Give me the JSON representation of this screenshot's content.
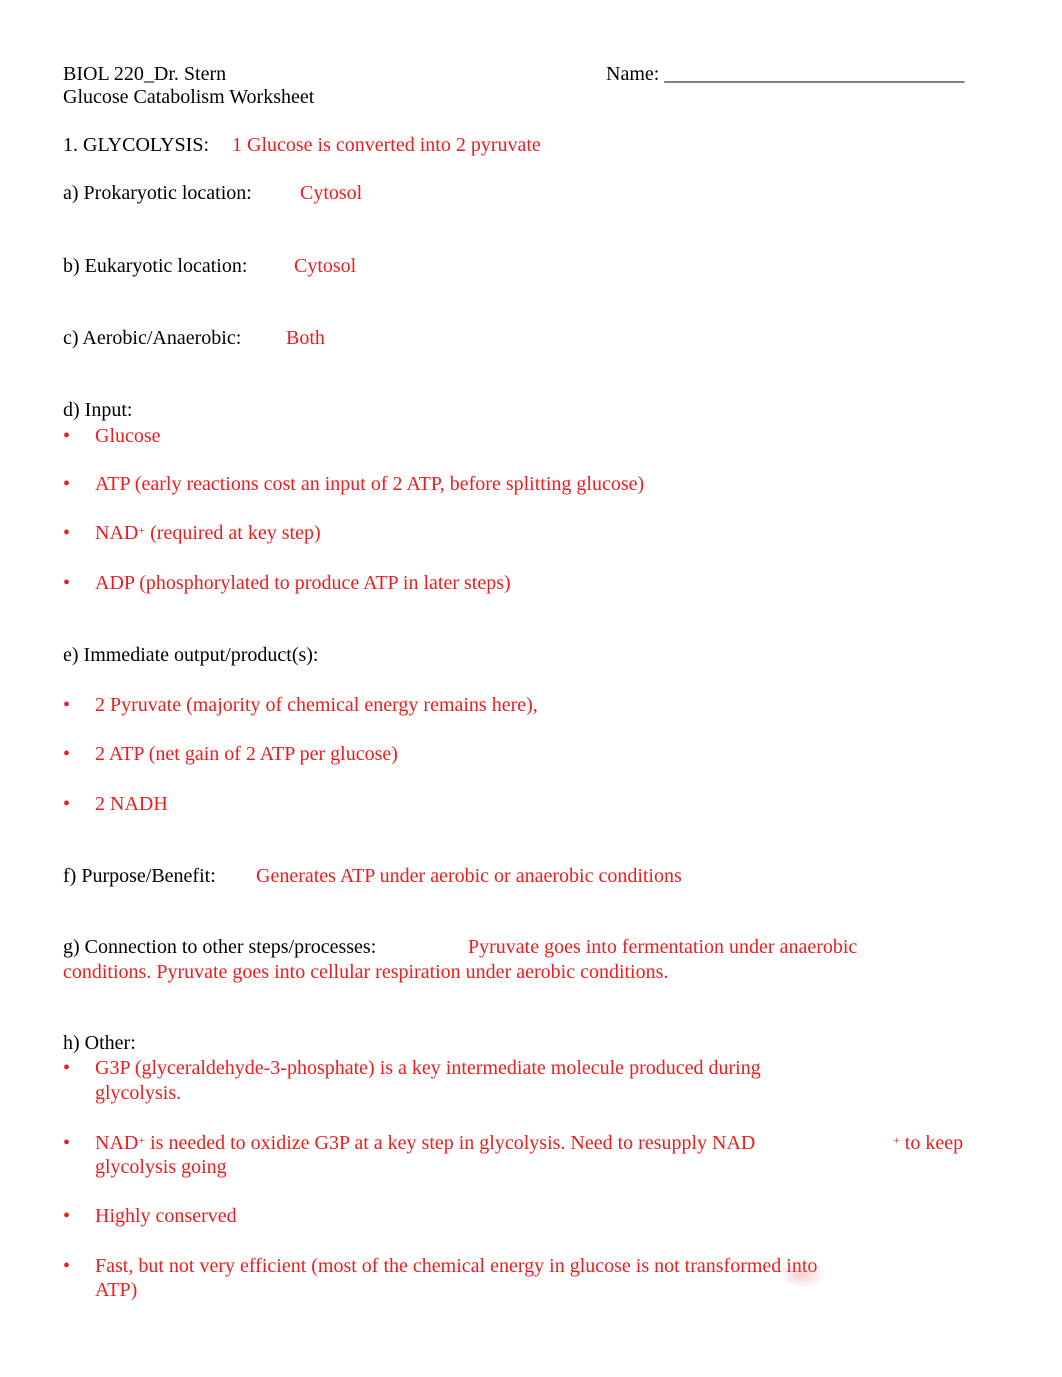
{
  "header": {
    "course": "BIOL 220_Dr. Stern",
    "title": "Glucose Catabolism Worksheet",
    "name_label": "Name:",
    "name_line": "______________________________"
  },
  "section": {
    "heading": "1. GLYCOLYSIS:",
    "summary": "1 Glucose is converted into 2 pyruvate"
  },
  "questions": {
    "a": {
      "label": "a) Prokaryotic location:",
      "answer": "Cytosol"
    },
    "b": {
      "label": "b) Eukaryotic location:",
      "answer": "Cytosol"
    },
    "c": {
      "label": "c) Aerobic/Anaerobic:",
      "answer": "Both"
    },
    "d": {
      "label": "d) Input:",
      "items": [
        "Glucose",
        "ATP (early reactions cost an input of 2 ATP, before splitting glucose)",
        "NAD",
        "ADP (phosphorylated to produce ATP in later steps)"
      ],
      "nad_sup": "+",
      "nad_rest": " (required at key step)"
    },
    "e": {
      "label": "e) Immediate output/product(s):",
      "items": [
        "2 Pyruvate (majority of chemical energy remains here),",
        "2 ATP (net gain of 2 ATP per glucose)",
        "2 NADH"
      ]
    },
    "f": {
      "label": "f) Purpose/Benefit:",
      "answer": "Generates ATP under aerobic or anaerobic conditions"
    },
    "g": {
      "label": "g) Connection to other steps/processes:",
      "answer_line1": "Pyruvate goes into fermentation under anaerobic",
      "answer_line2": "conditions. Pyruvate goes into cellular respiration under aerobic conditions."
    },
    "h": {
      "label": "h) Other:",
      "items": [
        {
          "line1": "G3P (glyceraldehyde-3-phosphate) is a key intermediate molecule produced during",
          "line2": "glycolysis."
        },
        {
          "line1a": "NAD",
          "sup": "+",
          "line1b": " is needed to oxidize G3P at a key step in glycolysis. Need to resupply NAD",
          "line1c": " to keep",
          "line2": "glycolysis going"
        },
        {
          "line1": "Highly conserved"
        },
        {
          "line1": "Fast, but not very efficient (most of the chemical energy in glucose is not transformed into",
          "line2": "ATP)"
        }
      ]
    },
    "bullet": "•"
  }
}
